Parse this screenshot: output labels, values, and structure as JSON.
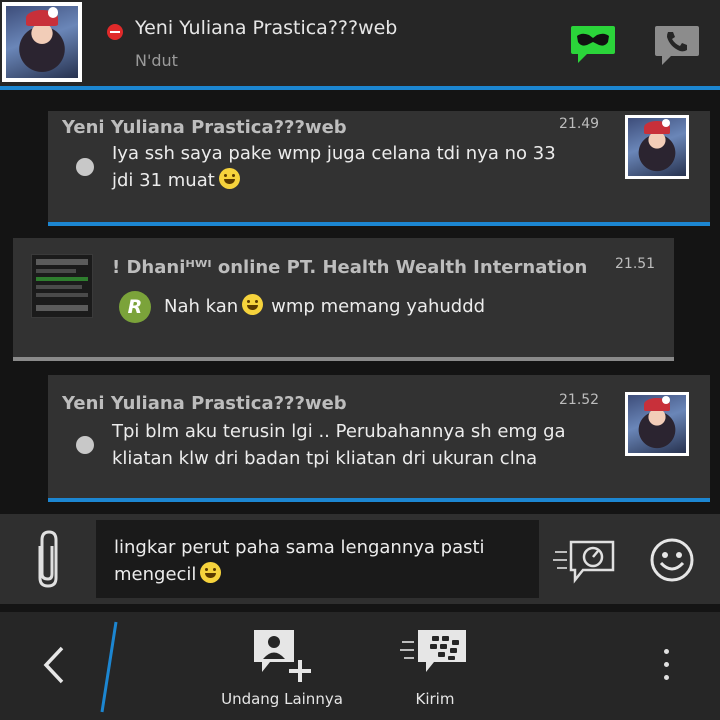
{
  "header": {
    "contact_name": "Yeni Yuliana Prastica???web",
    "contact_status": "N'dut",
    "status_color": "#e02a2a",
    "accent_color": "#1c86d1",
    "icons": [
      "busy-status-icon",
      "mask-icon",
      "phone-icon"
    ]
  },
  "messages": [
    {
      "sender": "Yeni Yuliana Prastica???web",
      "time": "21.49",
      "text": "Iya ssh saya pake wmp juga celana tdi nya no 33 jdi 31 muat",
      "emoji": "grinning-emoji-icon"
    },
    {
      "sender": "! Dhaniᴴᵂᴵ online PT. Health Wealth International",
      "time": "21.51",
      "badge": "R",
      "text_before": "Nah kan",
      "text_after": "wmp memang yahuddd",
      "emoji": "laughing-emoji-icon"
    },
    {
      "sender": "Yeni Yuliana Prastica???web",
      "time": "21.52",
      "text": "Tpi blm aku terusin lgi .. Perubahannya sh emg ga kliatan klw dri badan tpi kliatan dri ukuran clna"
    }
  ],
  "composer": {
    "value": "lingkar perut paha sama lengannya pasti mengecil",
    "emoji": "laughing-emoji-icon"
  },
  "bottom_bar": {
    "invite_label": "Undang Lainnya",
    "send_label": "Kirim"
  }
}
